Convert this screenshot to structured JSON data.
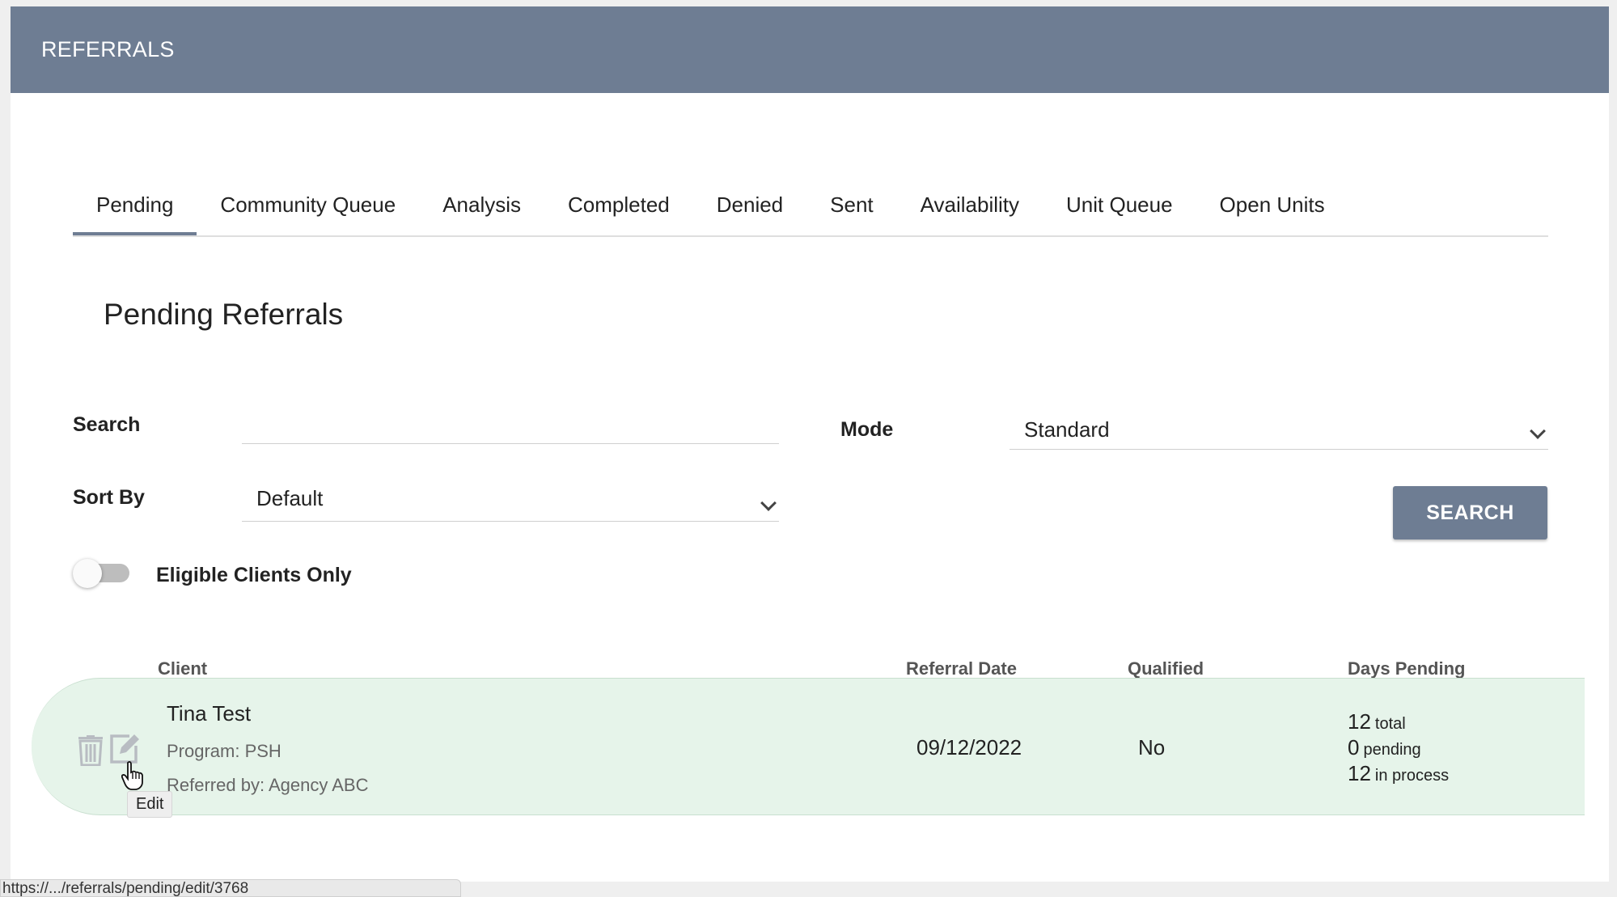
{
  "header": {
    "title": "REFERRALS"
  },
  "tabs": [
    {
      "label": "Pending",
      "active": true
    },
    {
      "label": "Community Queue"
    },
    {
      "label": "Analysis"
    },
    {
      "label": "Completed"
    },
    {
      "label": "Denied"
    },
    {
      "label": "Sent"
    },
    {
      "label": "Availability"
    },
    {
      "label": "Unit Queue"
    },
    {
      "label": "Open Units"
    }
  ],
  "page_title": "Pending Referrals",
  "filters": {
    "search_label": "Search",
    "search_value": "",
    "mode_label": "Mode",
    "mode_value": "Standard",
    "sort_label": "Sort By",
    "sort_value": "Default",
    "search_button": "SEARCH",
    "eligible_label": "Eligible Clients Only",
    "eligible_on": false
  },
  "table": {
    "headers": {
      "client": "Client",
      "referral_date": "Referral Date",
      "qualified": "Qualified",
      "days_pending": "Days Pending"
    },
    "rows": [
      {
        "client_name": "Tina Test",
        "program": "Program: PSH",
        "referred_by": "Referred by: Agency ABC",
        "referral_date": "09/12/2022",
        "qualified": "No",
        "days_total_num": "12",
        "days_total_label": "total",
        "days_pending_num": "0",
        "days_pending_label": "pending",
        "days_process_num": "12",
        "days_process_label": "in process",
        "icons": [
          "trash-icon",
          "edit-icon"
        ]
      }
    ]
  },
  "tooltip": "Edit",
  "status_bar": "https://.../referrals/pending/edit/3768",
  "colors": {
    "header_bg": "#6e7d93",
    "row_bg": "#e6f4ea",
    "button_bg": "#6e7d93"
  }
}
